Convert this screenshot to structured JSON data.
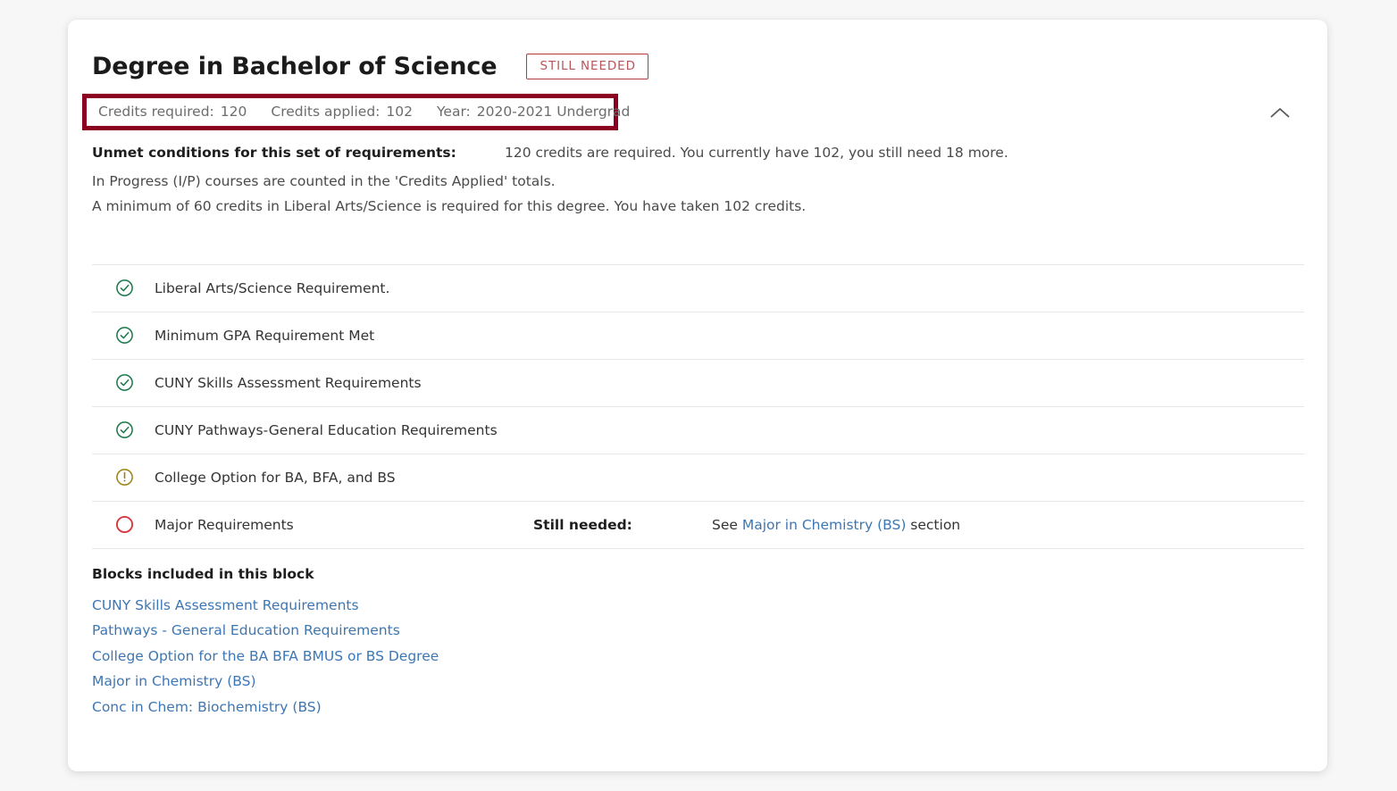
{
  "card": {
    "title": "Degree in Bachelor of Science",
    "status_badge": "STILL NEEDED",
    "collapse_icon": "chevron-up-icon"
  },
  "credits": {
    "required_label": "Credits required:",
    "required_value": "120",
    "applied_label": "Credits applied:",
    "applied_value": "102",
    "year_label": "Year:",
    "year_value": "2020-2021 Undergrad"
  },
  "unmet": {
    "label": "Unmet conditions for this set of requirements:",
    "message": "120 credits are required. You currently have 102, you still need 18 more.",
    "note_line_1": "In Progress (I/P) courses are counted in the 'Credits Applied' totals.",
    "note_line_2": "A minimum of 60 credits in Liberal Arts/Science is required for this degree. You have taken 102 credits."
  },
  "requirements": [
    {
      "status": "complete",
      "icon": "check-circle-icon",
      "name": "Liberal Arts/Science Requirement.",
      "still_needed_label": "",
      "detail_prefix": "",
      "detail_link": "",
      "detail_suffix": ""
    },
    {
      "status": "complete",
      "icon": "check-circle-icon",
      "name": "Minimum GPA Requirement Met",
      "still_needed_label": "",
      "detail_prefix": "",
      "detail_link": "",
      "detail_suffix": ""
    },
    {
      "status": "complete",
      "icon": "check-circle-icon",
      "name": "CUNY Skills Assessment Requirements",
      "still_needed_label": "",
      "detail_prefix": "",
      "detail_link": "",
      "detail_suffix": ""
    },
    {
      "status": "complete",
      "icon": "check-circle-icon",
      "name": "CUNY Pathways-General Education Requirements",
      "still_needed_label": "",
      "detail_prefix": "",
      "detail_link": "",
      "detail_suffix": ""
    },
    {
      "status": "in-progress",
      "icon": "exclamation-circle-icon",
      "name": "College Option for BA, BFA, and BS",
      "still_needed_label": "",
      "detail_prefix": "",
      "detail_link": "",
      "detail_suffix": ""
    },
    {
      "status": "incomplete",
      "icon": "empty-circle-icon",
      "name": "Major Requirements",
      "still_needed_label": "Still needed:",
      "detail_prefix": "See ",
      "detail_link": "Major in Chemistry (BS)",
      "detail_suffix": " section"
    }
  ],
  "blocks": {
    "title": "Blocks included in this block",
    "items": [
      "CUNY Skills Assessment Requirements",
      "Pathways - General Education Requirements",
      "College Option for the BA BFA BMUS or BS Degree",
      "Major in Chemistry (BS)",
      "Conc in Chem: Biochemistry (BS)"
    ]
  },
  "colors": {
    "highlight_box": "#8b0020",
    "badge_border": "#b23c3c",
    "badge_text": "#b9545a",
    "complete_green": "#19794c",
    "in_progress_yellow": "#9c8210",
    "incomplete_red": "#d6393f",
    "link_blue": "#3c77b4",
    "page_background": "#f7f7f7",
    "card_background": "#ffffff"
  }
}
